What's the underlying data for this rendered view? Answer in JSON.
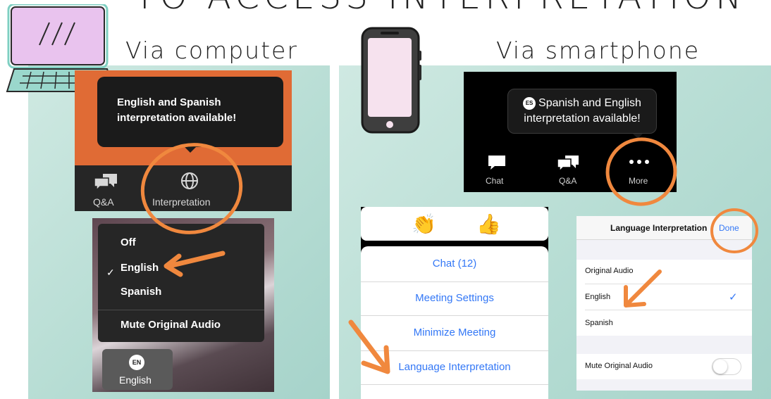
{
  "header": {
    "title": "TO ACCESS INTERPRETATION",
    "via_computer": "Via computer",
    "via_smartphone": "Via smartphone"
  },
  "computer": {
    "tooltip_line1": "English and Spanish",
    "tooltip_line2": "interpretation available!",
    "toolbar": {
      "qa_label": "Q&A",
      "interpretation_label": "Interpretation"
    },
    "menu": {
      "items": [
        "Off",
        "English",
        "Spanish",
        "Mute Original Audio"
      ],
      "selected": "English",
      "check_glyph": "✓"
    },
    "language_button": {
      "badge": "EN",
      "label": "English"
    }
  },
  "smartphone": {
    "tooltip": {
      "badge": "ES",
      "line1": "Spanish and English",
      "line2": "interpretation available!"
    },
    "toolbar": {
      "chat_label": "Chat",
      "qa_label": "Q&A",
      "more_label": "More"
    },
    "reactions": [
      "👏",
      "👍"
    ],
    "action_sheet": [
      "Chat (12)",
      "Meeting Settings",
      "Minimize Meeting",
      "Language Interpretation"
    ],
    "settings": {
      "title": "Language Interpretation",
      "done_label": "Done",
      "options": [
        "Original Audio",
        "English",
        "Spanish"
      ],
      "selected": "English",
      "check_glyph": "✓",
      "mute_label": "Mute Original Audio",
      "mute_on": false
    }
  },
  "colors": {
    "annotation_orange": "#f0883e",
    "zoom_orange": "#e06b35",
    "ios_blue": "#3478f6",
    "panel_teal": "#b7ddd4"
  },
  "icons": [
    "laptop-icon",
    "smartphone-icon",
    "qa-icon",
    "globe-icon",
    "chat-icon",
    "more-icon",
    "check-icon",
    "toggle-switch"
  ]
}
